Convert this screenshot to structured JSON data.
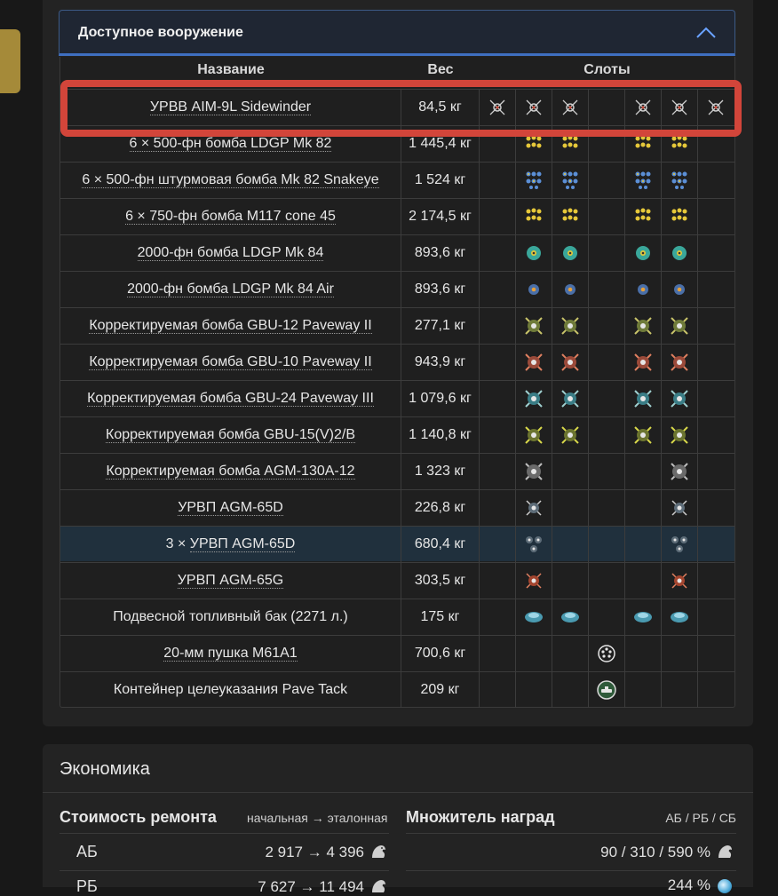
{
  "weapons_section": {
    "title": "Доступное вооружение",
    "columns": {
      "name": "Название",
      "weight": "Вес",
      "slots": "Слоты"
    },
    "rows": [
      {
        "name": "УРВВ AIM-9L Sidewinder",
        "weight": "84,5 кг",
        "slots": [
          "aam",
          "aam",
          "aam",
          "",
          "aam",
          "aam",
          "aam"
        ],
        "underline": true
      },
      {
        "name": "6 × 500-фн бомба LDGP Mk 82",
        "weight": "1 445,4 кг",
        "slots": [
          "",
          "bomb-y",
          "bomb-y",
          "",
          "bomb-y",
          "bomb-y",
          ""
        ],
        "underline": true
      },
      {
        "name": "6 × 500-фн штурмовая бомба Mk 82 Snakeye",
        "weight": "1 524 кг",
        "slots": [
          "",
          "bomb-b",
          "bomb-b",
          "",
          "bomb-b",
          "bomb-b",
          ""
        ],
        "underline": true
      },
      {
        "name": "6 × 750-фн бомба M117 cone 45",
        "weight": "2 174,5 кг",
        "slots": [
          "",
          "bomb-y",
          "bomb-y",
          "",
          "bomb-y",
          "bomb-y",
          ""
        ],
        "underline": true
      },
      {
        "name": "2000-фн бомба LDGP Mk 84",
        "weight": "893,6 кг",
        "slots": [
          "",
          "bomb-big",
          "bomb-big",
          "",
          "bomb-big",
          "bomb-big",
          ""
        ],
        "underline": true
      },
      {
        "name": "2000-фн бомба LDGP Mk 84 Air",
        "weight": "893,6 кг",
        "slots": [
          "",
          "bomb-air",
          "bomb-air",
          "",
          "bomb-air",
          "bomb-air",
          ""
        ],
        "underline": true
      },
      {
        "name": "Корректируемая бомба GBU-12 Paveway II",
        "weight": "277,1 кг",
        "slots": [
          "",
          "gb-olive",
          "gb-olive",
          "",
          "gb-olive",
          "gb-olive",
          ""
        ],
        "underline": true
      },
      {
        "name": "Корректируемая бомба GBU-10 Paveway II",
        "weight": "943,9 кг",
        "slots": [
          "",
          "gb-red",
          "gb-red",
          "",
          "gb-red",
          "gb-red",
          ""
        ],
        "underline": true
      },
      {
        "name": "Корректируемая бомба GBU-24 Paveway III",
        "weight": "1 079,6 кг",
        "slots": [
          "",
          "gb-teal",
          "gb-teal",
          "",
          "gb-teal",
          "gb-teal",
          ""
        ],
        "underline": true
      },
      {
        "name": "Корректируемая бомба GBU-15(V)2/B",
        "weight": "1 140,8 кг",
        "slots": [
          "",
          "gb-yellow",
          "gb-yellow",
          "",
          "gb-yellow",
          "gb-yellow",
          ""
        ],
        "underline": true
      },
      {
        "name": "Корректируемая бомба AGM-130A-12",
        "weight": "1 323 кг",
        "slots": [
          "",
          "gb-grey",
          "",
          "",
          "",
          "gb-grey",
          ""
        ],
        "underline": true
      },
      {
        "name": "УРВП AGM-65D",
        "weight": "226,8 кг",
        "slots": [
          "",
          "agm",
          "",
          "",
          "",
          "agm",
          ""
        ],
        "underline": true
      },
      {
        "name": "3 × УРВП AGM-65D",
        "weight": "680,4 кг",
        "slots": [
          "",
          "agm3",
          "",
          "",
          "",
          "agm3",
          ""
        ],
        "underline": true,
        "prefix": "3 × ",
        "core": "УРВП AGM-65D"
      },
      {
        "name": "УРВП AGM-65G",
        "weight": "303,5 кг",
        "slots": [
          "",
          "agm-red",
          "",
          "",
          "",
          "agm-red",
          ""
        ],
        "underline": true
      },
      {
        "name": "Подвесной топливный бак (2271 л.)",
        "weight": "175 кг",
        "slots": [
          "",
          "tank",
          "tank",
          "",
          "tank",
          "tank",
          ""
        ],
        "underline": false
      },
      {
        "name": "20-мм пушка M61A1",
        "weight": "700,6 кг",
        "slots": [
          "",
          "",
          "",
          "gun",
          "",
          "",
          ""
        ],
        "underline": true
      },
      {
        "name": "Контейнер целеуказания Pave Tack",
        "weight": "209 кг",
        "slots": [
          "",
          "",
          "",
          "pod",
          "",
          "",
          ""
        ],
        "underline": false
      }
    ]
  },
  "economy": {
    "title": "Экономика",
    "repair": {
      "title": "Стоимость ремонта",
      "subtitle": "начальная → эталонная",
      "rows": [
        {
          "mode": "АБ",
          "value": "2 917 → 4 396"
        },
        {
          "mode": "РБ",
          "value": "7 627 → 11 494"
        }
      ]
    },
    "rewards": {
      "title": "Множитель наград",
      "subtitle": "АБ / РБ / СБ",
      "rows": [
        {
          "value": "90 / 310 / 590 %"
        },
        {
          "value": "244 %"
        }
      ]
    }
  },
  "colors": {
    "accent": "#3f6fc1",
    "highlight": "#d2453a",
    "row_highlight": "#20303d"
  }
}
